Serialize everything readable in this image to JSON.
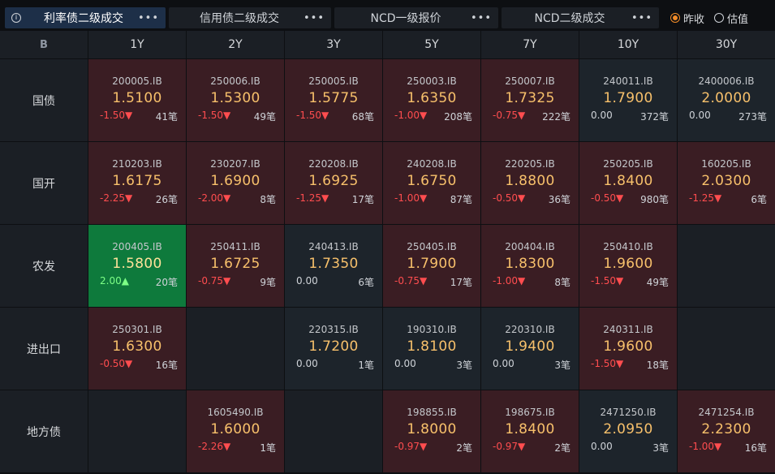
{
  "tabs": [
    {
      "label": "利率债二级成交",
      "active": true
    },
    {
      "label": "信用债二级成交",
      "active": false
    },
    {
      "label": "NCD一级报价",
      "active": false
    },
    {
      "label": "NCD二级成交",
      "active": false
    }
  ],
  "radios": [
    {
      "label": "昨收",
      "checked": true
    },
    {
      "label": "估值",
      "checked": false
    }
  ],
  "corner_logo": "B",
  "columns": [
    "1Y",
    "2Y",
    "3Y",
    "5Y",
    "7Y",
    "10Y",
    "30Y"
  ],
  "rows": [
    {
      "label": "国债",
      "cells": [
        {
          "code": "200005.IB",
          "rate": "1.5100",
          "change": "-1.50▼",
          "count": "41笔",
          "tone": "down"
        },
        {
          "code": "250006.IB",
          "rate": "1.5300",
          "change": "-1.50▼",
          "count": "49笔",
          "tone": "down"
        },
        {
          "code": "250005.IB",
          "rate": "1.5775",
          "change": "-1.50▼",
          "count": "68笔",
          "tone": "down"
        },
        {
          "code": "250003.IB",
          "rate": "1.6350",
          "change": "-1.00▼",
          "count": "208笔",
          "tone": "down"
        },
        {
          "code": "250007.IB",
          "rate": "1.7325",
          "change": "-0.75▼",
          "count": "222笔",
          "tone": "down"
        },
        {
          "code": "240011.IB",
          "rate": "1.7900",
          "change": "0.00",
          "count": "372笔",
          "tone": "neutral"
        },
        {
          "code": "2400006.IB",
          "rate": "2.0000",
          "change": "0.00",
          "count": "273笔",
          "tone": "neutral"
        }
      ]
    },
    {
      "label": "国开",
      "cells": [
        {
          "code": "210203.IB",
          "rate": "1.6175",
          "change": "-2.25▼",
          "count": "26笔",
          "tone": "down"
        },
        {
          "code": "230207.IB",
          "rate": "1.6900",
          "change": "-2.00▼",
          "count": "8笔",
          "tone": "down"
        },
        {
          "code": "220208.IB",
          "rate": "1.6925",
          "change": "-1.25▼",
          "count": "17笔",
          "tone": "down"
        },
        {
          "code": "240208.IB",
          "rate": "1.6750",
          "change": "-1.00▼",
          "count": "87笔",
          "tone": "down"
        },
        {
          "code": "220205.IB",
          "rate": "1.8800",
          "change": "-0.50▼",
          "count": "36笔",
          "tone": "down"
        },
        {
          "code": "250205.IB",
          "rate": "1.8400",
          "change": "-0.50▼",
          "count": "980笔",
          "tone": "down"
        },
        {
          "code": "160205.IB",
          "rate": "2.0300",
          "change": "-1.25▼",
          "count": "6笔",
          "tone": "down"
        }
      ]
    },
    {
      "label": "农发",
      "cells": [
        {
          "code": "200405.IB",
          "rate": "1.5800",
          "change": "2.00▲",
          "count": "20笔",
          "tone": "up"
        },
        {
          "code": "250411.IB",
          "rate": "1.6725",
          "change": "-0.75▼",
          "count": "9笔",
          "tone": "down"
        },
        {
          "code": "240413.IB",
          "rate": "1.7350",
          "change": "0.00",
          "count": "6笔",
          "tone": "neutral"
        },
        {
          "code": "250405.IB",
          "rate": "1.7900",
          "change": "-0.75▼",
          "count": "17笔",
          "tone": "down"
        },
        {
          "code": "200404.IB",
          "rate": "1.8300",
          "change": "-1.00▼",
          "count": "8笔",
          "tone": "down"
        },
        {
          "code": "250410.IB",
          "rate": "1.9600",
          "change": "-1.50▼",
          "count": "49笔",
          "tone": "down"
        },
        null
      ]
    },
    {
      "label": "进出口",
      "cells": [
        {
          "code": "250301.IB",
          "rate": "1.6300",
          "change": "-0.50▼",
          "count": "16笔",
          "tone": "down"
        },
        null,
        {
          "code": "220315.IB",
          "rate": "1.7200",
          "change": "0.00",
          "count": "1笔",
          "tone": "neutral"
        },
        {
          "code": "190310.IB",
          "rate": "1.8100",
          "change": "0.00",
          "count": "3笔",
          "tone": "neutral"
        },
        {
          "code": "220310.IB",
          "rate": "1.9400",
          "change": "0.00",
          "count": "3笔",
          "tone": "neutral"
        },
        {
          "code": "240311.IB",
          "rate": "1.9600",
          "change": "-1.50▼",
          "count": "18笔",
          "tone": "down"
        },
        null
      ]
    },
    {
      "label": "地方债",
      "cells": [
        null,
        {
          "code": "1605490.IB",
          "rate": "1.6000",
          "change": "-2.26▼",
          "count": "1笔",
          "tone": "down"
        },
        null,
        {
          "code": "198855.IB",
          "rate": "1.8000",
          "change": "-0.97▼",
          "count": "2笔",
          "tone": "down"
        },
        {
          "code": "198675.IB",
          "rate": "1.8400",
          "change": "-0.97▼",
          "count": "2笔",
          "tone": "down"
        },
        {
          "code": "2471250.IB",
          "rate": "2.0950",
          "change": "0.00",
          "count": "3笔",
          "tone": "neutral"
        },
        {
          "code": "2471254.IB",
          "rate": "2.2300",
          "change": "-1.00▼",
          "count": "16笔",
          "tone": "down"
        }
      ]
    }
  ]
}
